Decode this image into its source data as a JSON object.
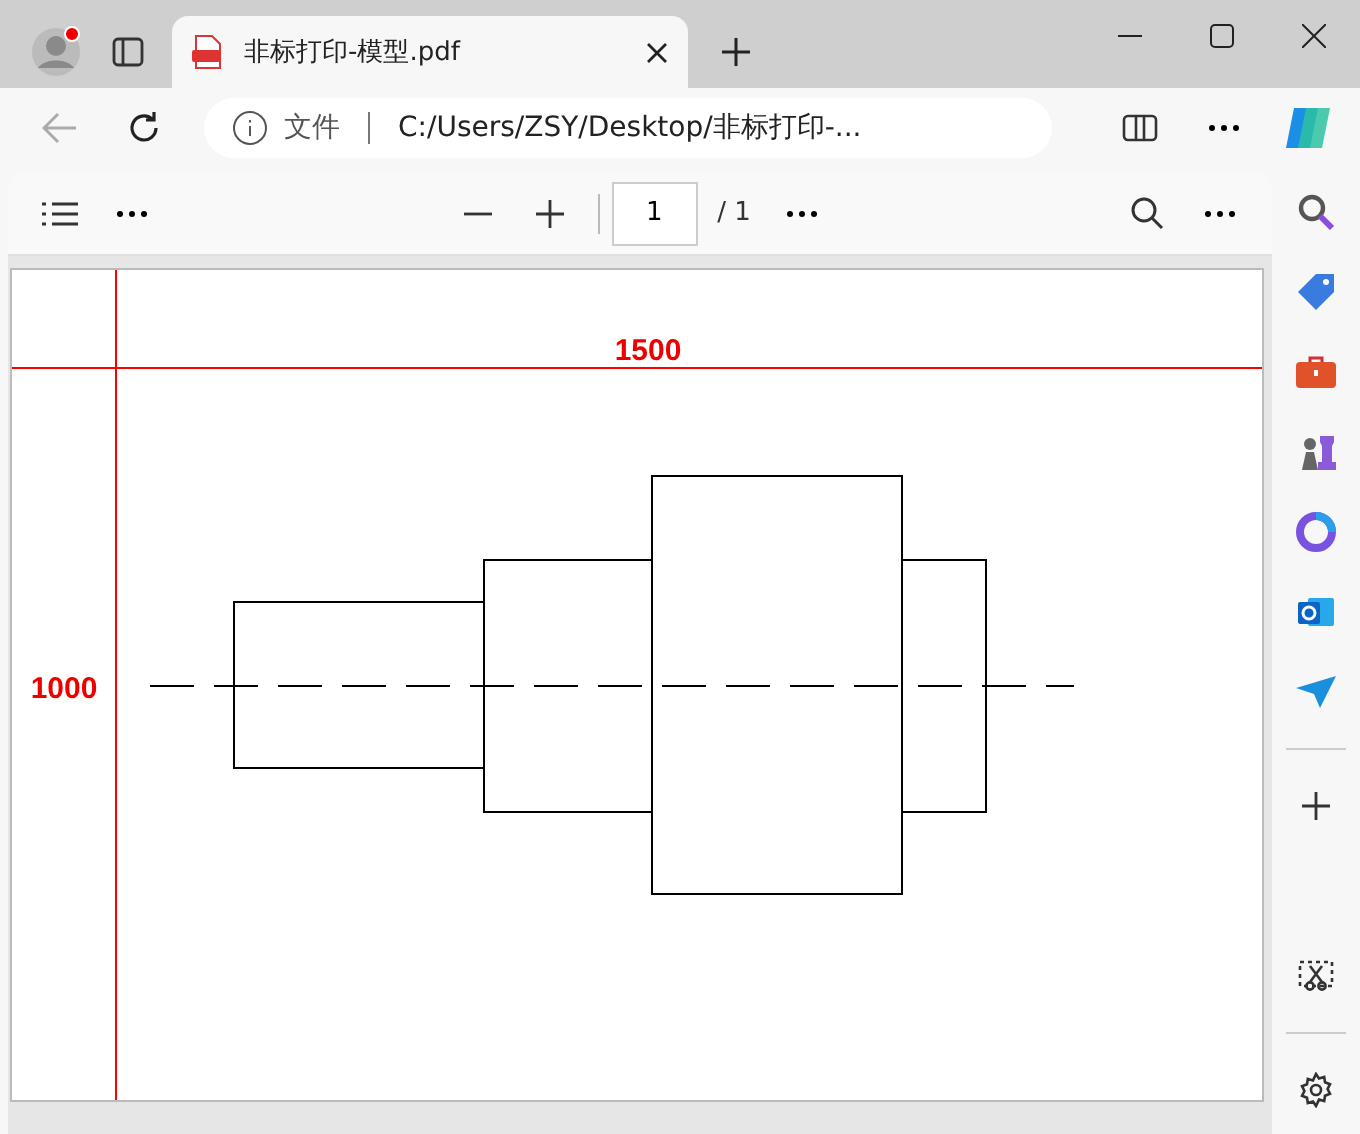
{
  "tabs": [
    {
      "title": "非标打印-模型.pdf",
      "selected": true
    }
  ],
  "address": {
    "scheme": "文件",
    "url": "C:/Users/ZSY/Desktop/非标打印-..."
  },
  "pdf_toolbar": {
    "page": "1",
    "total": "/ 1"
  },
  "drawing": {
    "width_label": "1500",
    "height_label": "1000"
  }
}
